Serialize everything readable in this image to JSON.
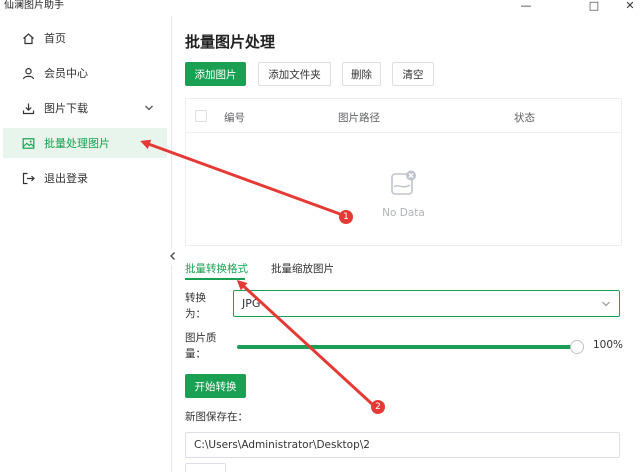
{
  "app": {
    "title": "仙澜图片助手"
  },
  "window": {
    "minimize": "—",
    "maximize": "□",
    "close": "✕"
  },
  "sidebar": {
    "items": [
      {
        "label": "首页",
        "icon": "home-icon"
      },
      {
        "label": "会员中心",
        "icon": "user-icon"
      },
      {
        "label": "图片下载",
        "icon": "download-icon",
        "expandable": true
      },
      {
        "label": "批量处理图片",
        "icon": "image-icon",
        "active": true
      },
      {
        "label": "退出登录",
        "icon": "logout-icon"
      }
    ]
  },
  "main": {
    "title": "批量图片处理",
    "toolbar": {
      "add_image": "添加图片",
      "add_folder": "添加文件夹",
      "delete": "删除",
      "clear": "清空"
    },
    "table": {
      "columns": [
        "编号",
        "图片路径",
        "状态"
      ],
      "rows": [],
      "empty_text": "No Data"
    },
    "tabs": [
      {
        "label": "批量转换格式",
        "active": true
      },
      {
        "label": "批量缩放图片",
        "active": false
      }
    ],
    "convert": {
      "label_line1": "转换",
      "label_line2": "为：",
      "format_value": "JPG"
    },
    "quality": {
      "label_line1": "图片质",
      "label_line2": "量：",
      "value": 100,
      "value_text": "100%"
    },
    "start_label": "开始转换",
    "save_label": "新图保存在：",
    "save_path": "C:\\Users\\Administrator\\Desktop\\2"
  },
  "annotations": [
    {
      "number": "1"
    },
    {
      "number": "2"
    }
  ],
  "colors": {
    "accent": "#1aa052",
    "active_bg": "#e8f5ed",
    "annotation": "#e53935"
  }
}
